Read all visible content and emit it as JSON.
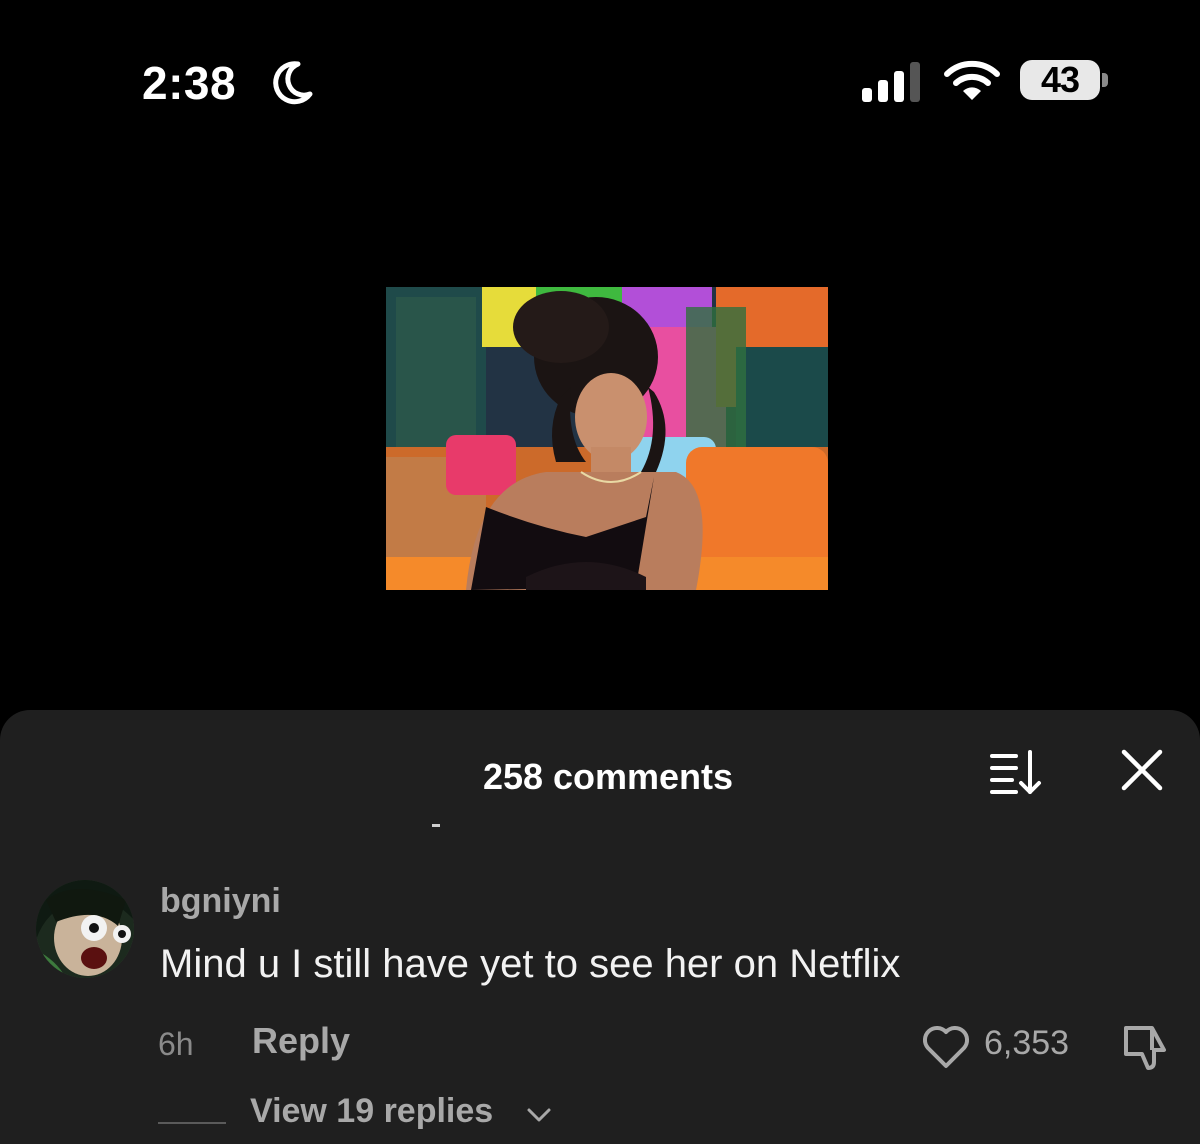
{
  "status_bar": {
    "time": "2:38",
    "battery_level": "43",
    "icons": [
      "moon-icon",
      "signal-icon",
      "wifi-icon",
      "battery-icon"
    ]
  },
  "video": {
    "thumbnail_icon": "video-thumbnail"
  },
  "comments_sheet": {
    "title": "258 comments",
    "sort_icon": "sort-icon",
    "close_icon": "close-icon"
  },
  "comment": {
    "username": "bgniyni",
    "text": "Mind u I still have yet to see her on Netflix",
    "timestamp": "6h",
    "reply_label": "Reply",
    "like_count": "6,353",
    "view_replies_label": "View 19 replies",
    "icons": [
      "avatar",
      "heart-icon",
      "dislike-icon",
      "chevron-down-icon"
    ]
  },
  "colors": {
    "background": "#000000",
    "sheet": "#1f1f1f",
    "muted_text": "#a8a8a8"
  }
}
